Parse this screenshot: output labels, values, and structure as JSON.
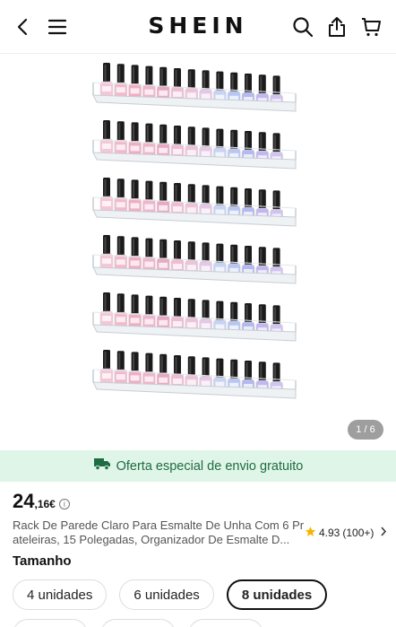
{
  "header": {
    "brand": "SHEIN",
    "icons": [
      "back-icon",
      "menu-icon",
      "search-icon",
      "share-icon",
      "cart-icon"
    ]
  },
  "gallery": {
    "counter": "1 / 6",
    "shelf_count": 6,
    "bottle_colors": [
      "#f4c6d6",
      "#f2b9cd",
      "#efadc4",
      "#eeb5cc",
      "#e9a8c2",
      "#f0bcd2",
      "#ecc3d8",
      "#e5c8e6",
      "#c7d3f4",
      "#b9c6f2",
      "#b4b9ef",
      "#c2b8ef",
      "#d1c4f1"
    ]
  },
  "promo": {
    "text": "Oferta especial de envio gratuito",
    "color": "#1f6b43"
  },
  "product": {
    "price_int": "24",
    "price_dec": ",16€",
    "title_line1": "Rack De Parede Claro Para Esmalte De Unha Com 6 Pr",
    "title_line2": "ateleiras, 15 Polegadas, Organizador De Esmalte D...",
    "rating": "4.93",
    "rating_count": "(100+)"
  },
  "size": {
    "label": "Tamanho",
    "options": [
      "4 unidades",
      "6 unidades",
      "8 unidades"
    ],
    "selected": "8 unidades"
  }
}
